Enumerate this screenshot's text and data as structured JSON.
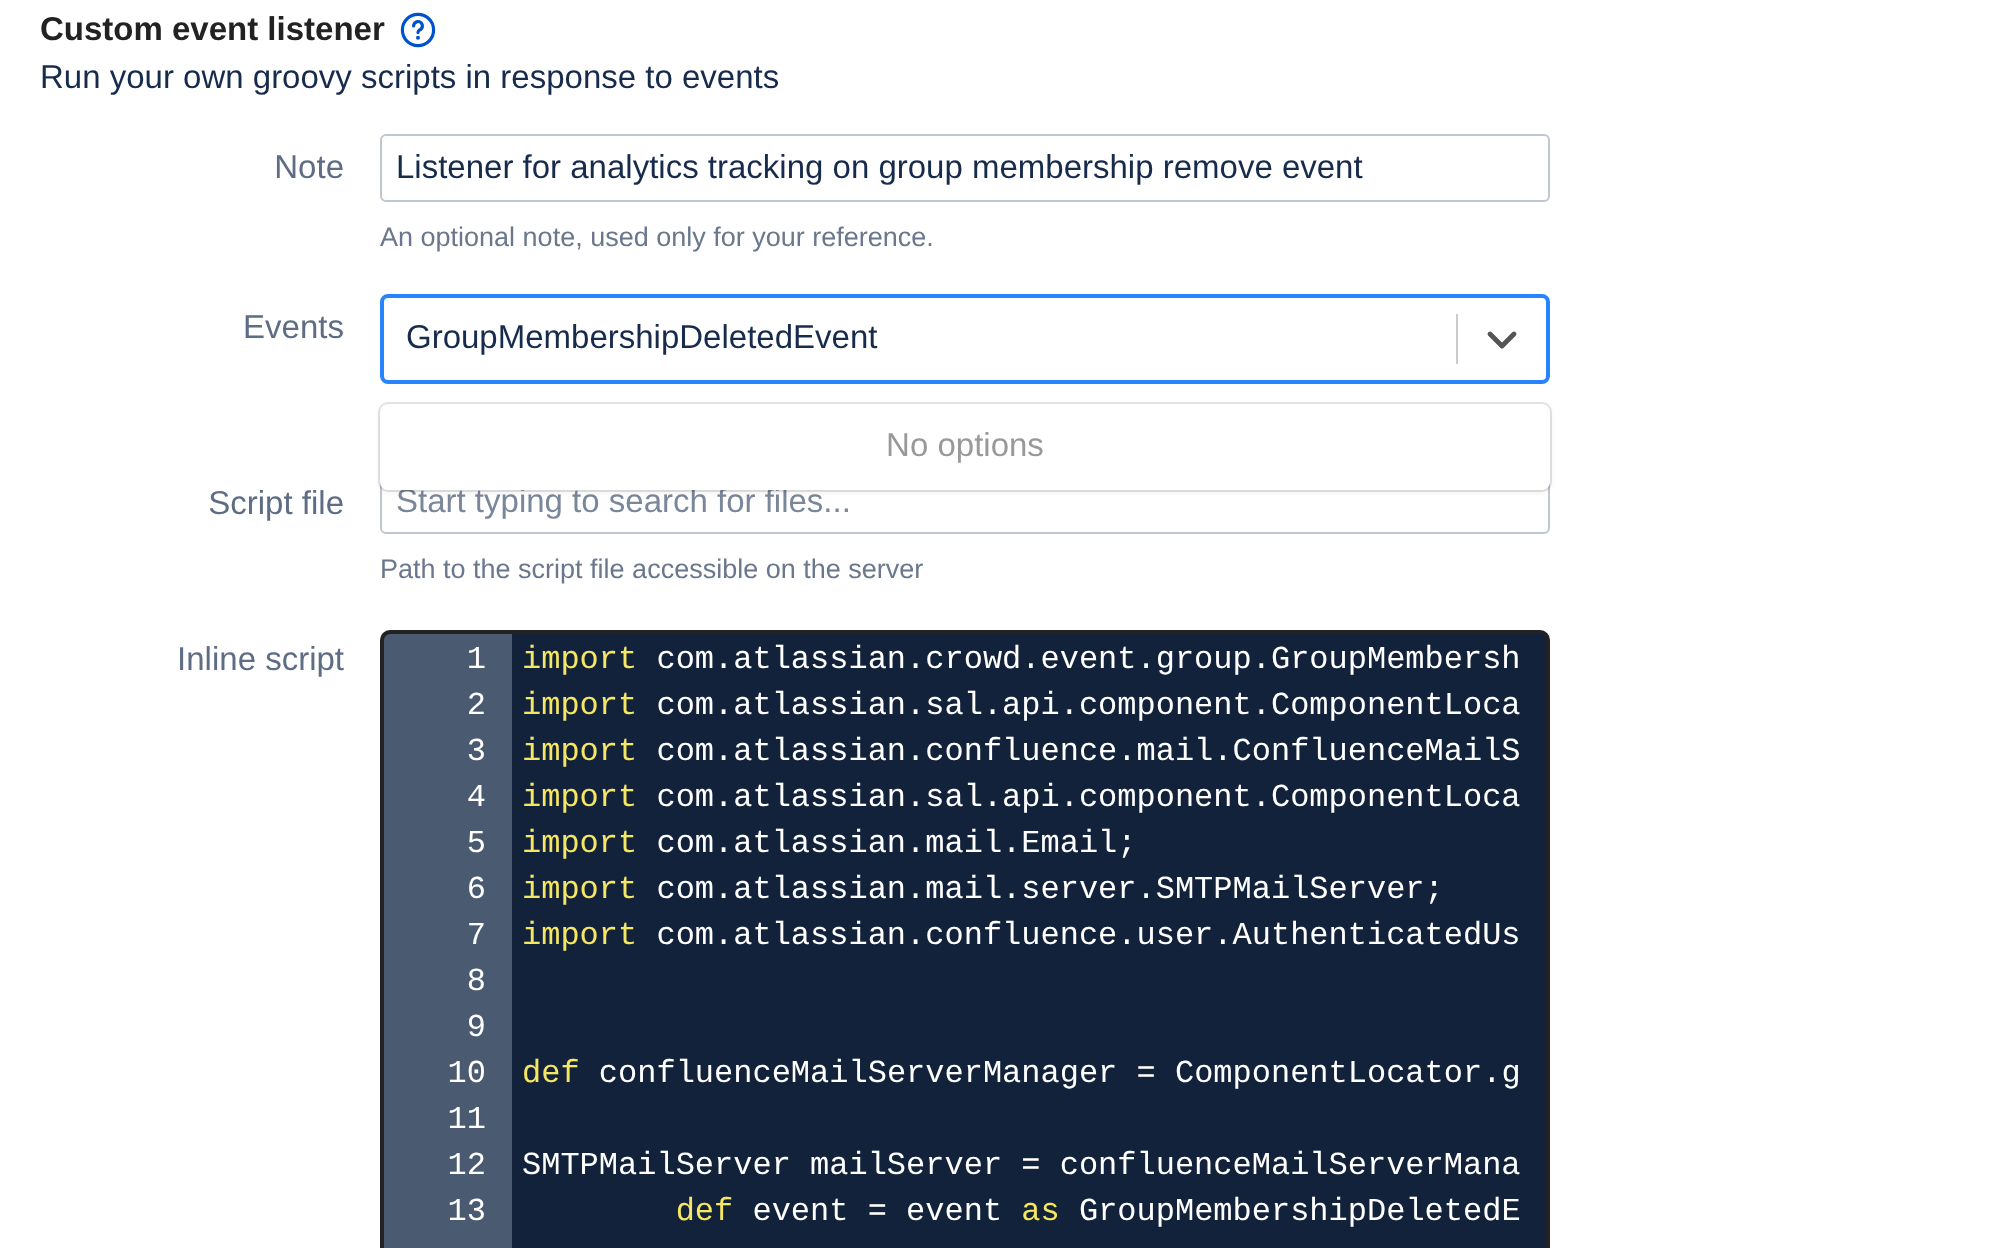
{
  "header": {
    "title": "Custom event listener",
    "subtitle": "Run your own groovy scripts in response to events"
  },
  "note": {
    "label": "Note",
    "value": "Listener for analytics tracking on group membership remove event",
    "help": "An optional note, used only for your reference."
  },
  "events": {
    "label": "Events",
    "value": "GroupMembershipDeletedEvent",
    "expanded": true,
    "menu_message": "No options"
  },
  "script_file": {
    "label": "Script file",
    "placeholder": "Start typing to search for files...",
    "help": "Path to the script file accessible on the server"
  },
  "inline_script": {
    "label": "Inline script",
    "lines": [
      {
        "number": "1",
        "tokens": [
          {
            "text": "import",
            "keyword": true
          },
          {
            "text": " com.atlassian.crowd.event.group.GroupMembersh",
            "keyword": false
          }
        ]
      },
      {
        "number": "2",
        "tokens": [
          {
            "text": "import",
            "keyword": true
          },
          {
            "text": " com.atlassian.sal.api.component.ComponentLoca",
            "keyword": false
          }
        ]
      },
      {
        "number": "3",
        "tokens": [
          {
            "text": "import",
            "keyword": true
          },
          {
            "text": " com.atlassian.confluence.mail.ConfluenceMailS",
            "keyword": false
          }
        ]
      },
      {
        "number": "4",
        "tokens": [
          {
            "text": "import",
            "keyword": true
          },
          {
            "text": " com.atlassian.sal.api.component.ComponentLoca",
            "keyword": false
          }
        ]
      },
      {
        "number": "5",
        "tokens": [
          {
            "text": "import",
            "keyword": true
          },
          {
            "text": " com.atlassian.mail.Email;",
            "keyword": false
          }
        ]
      },
      {
        "number": "6",
        "tokens": [
          {
            "text": "import",
            "keyword": true
          },
          {
            "text": " com.atlassian.mail.server.SMTPMailServer;",
            "keyword": false
          }
        ]
      },
      {
        "number": "7",
        "tokens": [
          {
            "text": "import",
            "keyword": true
          },
          {
            "text": " com.atlassian.confluence.user.AuthenticatedUs",
            "keyword": false
          }
        ]
      },
      {
        "number": "8"
      },
      {
        "number": "9"
      },
      {
        "number": "10",
        "tokens": [
          {
            "text": "def",
            "keyword": true
          },
          {
            "text": " confluenceMailServerManager = ComponentLocator.g",
            "keyword": false
          }
        ]
      },
      {
        "number": "11"
      },
      {
        "number": "12",
        "tokens": [
          {
            "text": "SMTPMailServer mailServer = confluenceMailServerMana",
            "keyword": false
          }
        ]
      },
      {
        "number": "13",
        "indent": true,
        "tokens": [
          {
            "text": "def",
            "keyword": true
          },
          {
            "text": " event = event ",
            "keyword": false
          },
          {
            "text": "as",
            "keyword": true
          },
          {
            "text": " GroupMembershipDeletedE",
            "keyword": false
          }
        ]
      }
    ]
  }
}
